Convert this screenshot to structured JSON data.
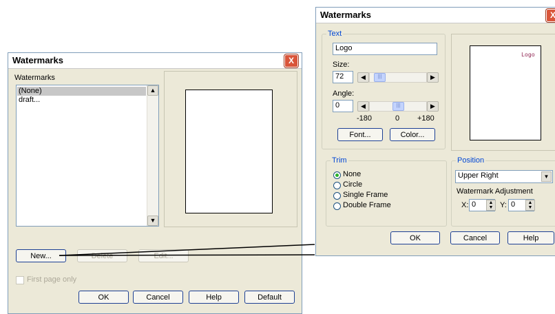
{
  "left_dialog": {
    "title": "Watermarks",
    "close_glyph": "X",
    "list_label": "Watermarks",
    "list_items": [
      "(None)",
      "draft..."
    ],
    "buttons": {
      "new": "New...",
      "delete": "Delete",
      "edit": "Edit..."
    },
    "checkbox_first_page": "First page only",
    "footer": {
      "ok": "OK",
      "cancel": "Cancel",
      "help": "Help",
      "default": "Default"
    }
  },
  "right_dialog": {
    "title": "Watermarks",
    "close_glyph": "X",
    "text_group": {
      "label": "Text",
      "text_value": "Logo",
      "size_label": "Size:",
      "size_value": "72",
      "angle_label": "Angle:",
      "angle_value": "0",
      "angle_min": "-180",
      "angle_mid": "0",
      "angle_max": "+180",
      "font_button": "Font...",
      "color_button": "Color..."
    },
    "preview_text": "Logo",
    "trim_group": {
      "label": "Trim",
      "options": [
        "None",
        "Circle",
        "Single Frame",
        "Double Frame"
      ],
      "selected": "None"
    },
    "position_group": {
      "label": "Position",
      "selected": "Upper Right",
      "adjust_label": "Watermark Adjustment",
      "x_label": "X:",
      "x_value": "0",
      "y_label": "Y:",
      "y_value": "0"
    },
    "footer": {
      "ok": "OK",
      "cancel": "Cancel",
      "help": "Help"
    }
  },
  "colors": {
    "preview_text": "#8b1a4a",
    "group_label": "#0046d5",
    "selection": "#c7c7c7"
  }
}
